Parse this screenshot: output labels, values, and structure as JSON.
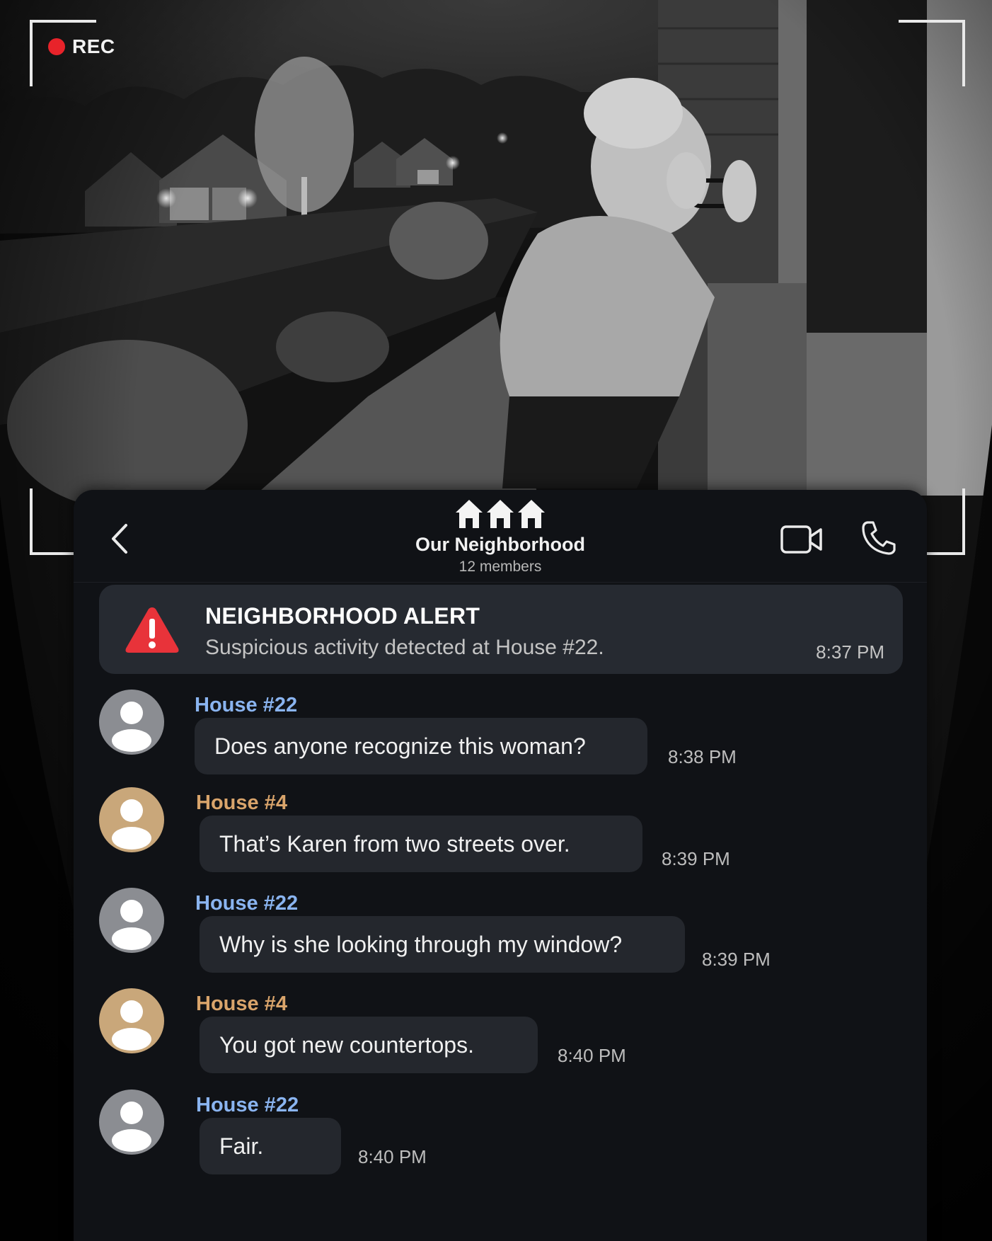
{
  "recording": {
    "label": "REC",
    "dot_color": "#e8232a"
  },
  "chat": {
    "group_name": "Our Neighborhood",
    "member_count": "12 members",
    "alert": {
      "title": "NEIGHBORHOOD ALERT",
      "text": "Suspicious activity detected at House #22.",
      "time": "8:37 PM",
      "color": "#e8333a"
    },
    "messages": [
      {
        "sender": "House #22",
        "text": "Does anyone recognize this woman?",
        "time": "8:38 PM",
        "avatar": "gray"
      },
      {
        "sender": "House #4",
        "text": "That’s Karen from two streets over.",
        "time": "8:39 PM",
        "avatar": "tan"
      },
      {
        "sender": "House #22",
        "text": "Why is she looking through my window?",
        "time": "8:39 PM",
        "avatar": "gray"
      },
      {
        "sender": "House #4",
        "text": "You got new countertops.",
        "time": "8:40 PM",
        "avatar": "tan"
      },
      {
        "sender": "House #22",
        "text": "Fair.",
        "time": "8:40 PM",
        "avatar": "gray"
      }
    ],
    "colors": {
      "house22": "#8ab4f0",
      "house4": "#d9a46b",
      "panel": "#101216",
      "bubble": "#24272d"
    },
    "icons": [
      "back-chevron-icon",
      "houses-icon",
      "video-camera-icon",
      "phone-icon",
      "warning-icon",
      "person-icon"
    ]
  }
}
